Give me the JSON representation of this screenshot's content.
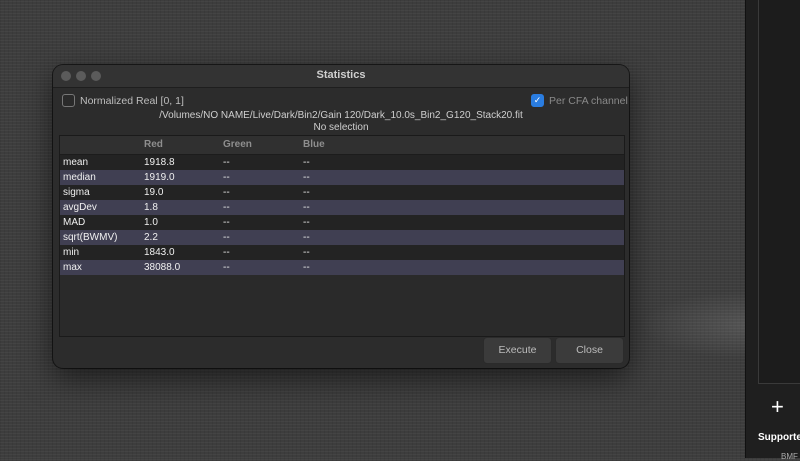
{
  "window": {
    "title": "Statistics",
    "normalized_label": "Normalized Real [0, 1]",
    "per_cfa_label": "Per CFA channel",
    "per_cfa_checked": true,
    "file_path": "/Volumes/NO NAME/Live/Dark/Bin2/Gain 120/Dark_10.0s_Bin2_G120_Stack20.fit",
    "selection": "No selection"
  },
  "table": {
    "headers": [
      "",
      "Red",
      "Green",
      "Blue"
    ],
    "rows": [
      {
        "name": "mean",
        "red": "1918.8",
        "green": "--",
        "blue": "--"
      },
      {
        "name": "median",
        "red": "1919.0",
        "green": "--",
        "blue": "--"
      },
      {
        "name": "sigma",
        "red": "19.0",
        "green": "--",
        "blue": "--"
      },
      {
        "name": "avgDev",
        "red": "1.8",
        "green": "--",
        "blue": "--"
      },
      {
        "name": "MAD",
        "red": "1.0",
        "green": "--",
        "blue": "--"
      },
      {
        "name": "sqrt(BWMV)",
        "red": "2.2",
        "green": "--",
        "blue": "--"
      },
      {
        "name": "min",
        "red": "1843.0",
        "green": "--",
        "blue": "--"
      },
      {
        "name": "max",
        "red": "38088.0",
        "green": "--",
        "blue": "--"
      }
    ]
  },
  "buttons": {
    "execute": "Execute",
    "close": "Close"
  },
  "side_panel": {
    "add_symbol": "+",
    "supported_label": "Supporte",
    "bms_label": "BMF"
  },
  "colors": {
    "accent": "#2a7de1",
    "row_alt": "#403f52",
    "row_base": "#232323"
  }
}
